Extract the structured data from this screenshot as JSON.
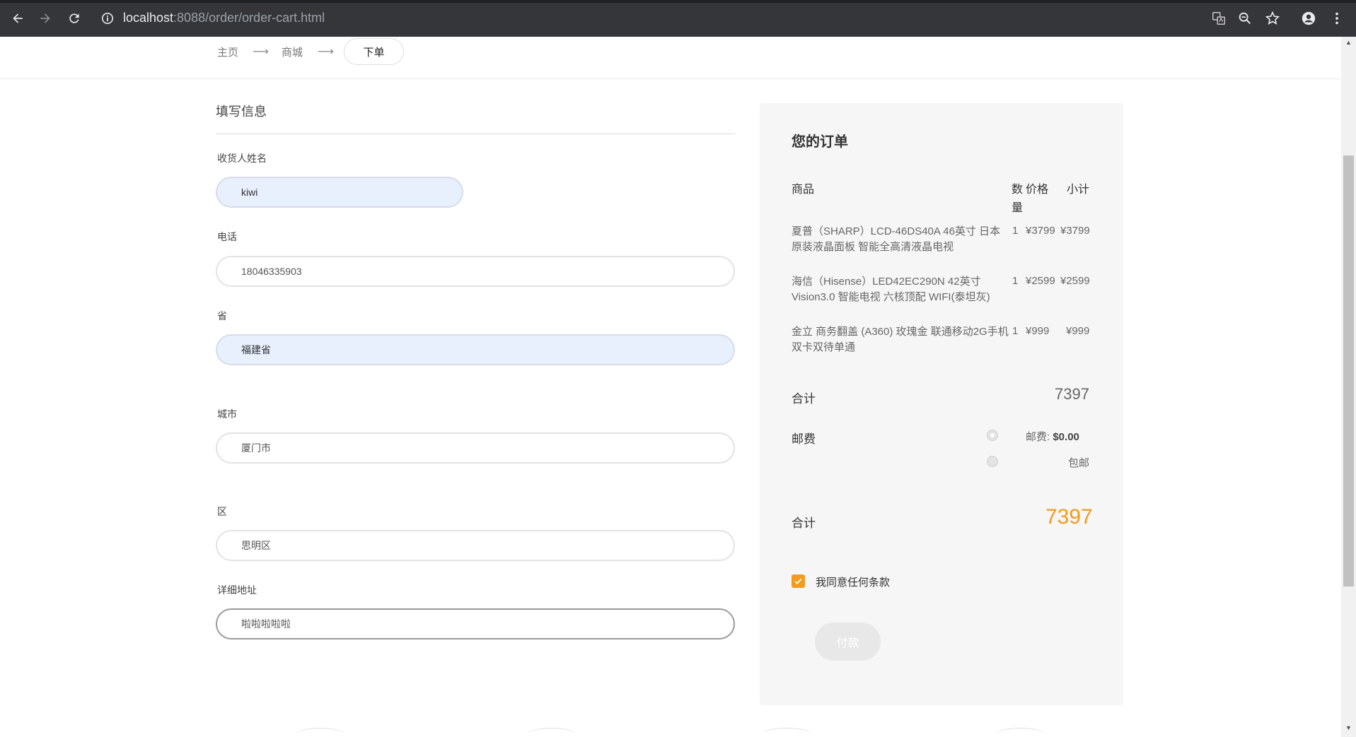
{
  "browser": {
    "url_host": "localhost",
    "url_rest": ":8088/order/order-cart.html"
  },
  "breadcrumb": {
    "home": "主页",
    "mall": "商城",
    "current": "下单",
    "arrow": "⟶"
  },
  "form": {
    "title": "填写信息",
    "name_label": "收货人姓名",
    "name_value": "kiwi",
    "phone_label": "电话",
    "phone_value": "18046335903",
    "province_label": "省",
    "province_value": "福建省",
    "city_label": "城市",
    "city_value": "厦门市",
    "district_label": "区",
    "district_value": "思明区",
    "address_label": "详细地址",
    "address_value": "啦啦啦啦啦"
  },
  "order": {
    "title": "您的订单",
    "col_product": "商品",
    "col_qty_1": "数",
    "col_qty_2": "量",
    "col_price": "价格",
    "col_subtotal": "小计",
    "items": [
      {
        "name": "夏普（SHARP）LCD-46DS40A 46英寸 日本原装液晶面板 智能全高清液晶电视",
        "qty": "1",
        "price": "¥3799",
        "subtotal": "¥3799"
      },
      {
        "name": "海信（Hisense）LED42EC290N 42英寸 Vision3.0 智能电视 六核顶配 WIFI(泰坦灰)",
        "qty": "1",
        "price": "¥2599",
        "subtotal": "¥2599"
      },
      {
        "name": "金立 商务翻盖 (A360) 玫瑰金 联通移动2G手机 双卡双待单通",
        "qty": "1",
        "price": "¥999",
        "subtotal": "¥999"
      }
    ],
    "total_label": "合计",
    "total_value": "7397",
    "shipping_label": "邮费",
    "shipping_option_1_prefix": "邮费:",
    "shipping_option_1_value": "$0.00",
    "shipping_option_2": "包邮",
    "grand_label": "合计",
    "grand_value": "7397",
    "agree_text": "我同意任何条款",
    "pay_label": "付款"
  },
  "colors": {
    "accent": "#f29b1e",
    "chrome": "#35363a"
  }
}
